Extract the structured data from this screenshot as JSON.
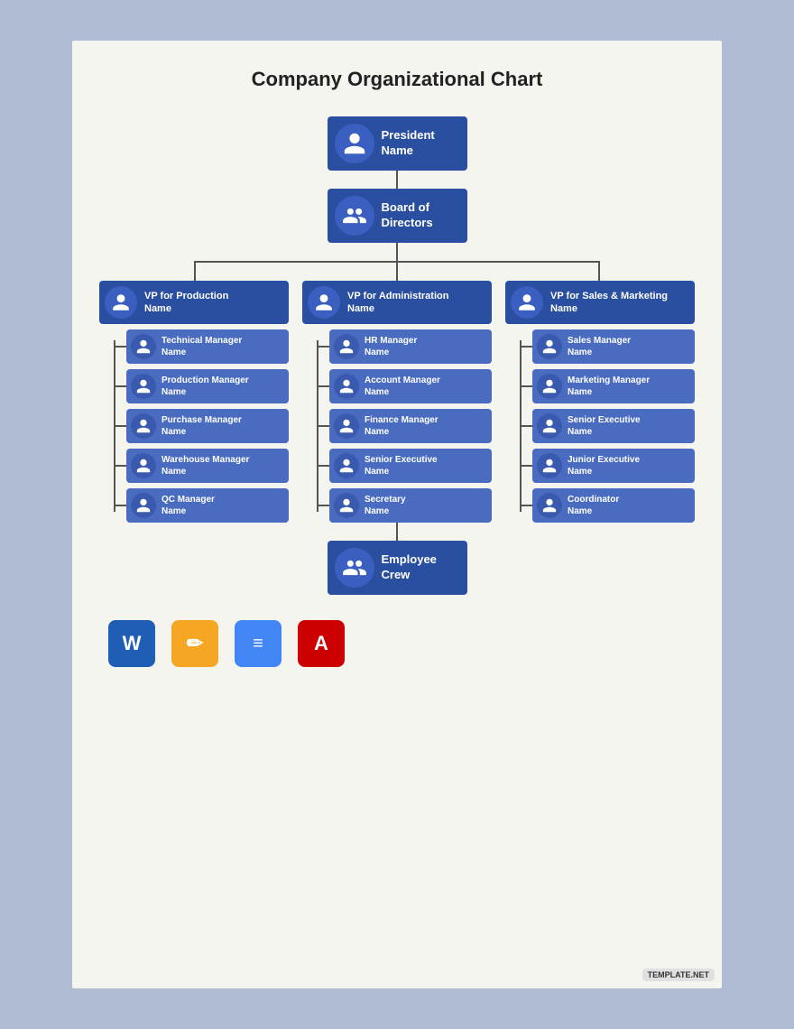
{
  "page": {
    "background": "#b0bcd4",
    "title": "Company Organizational Chart"
  },
  "nodes": {
    "president": {
      "label": "President",
      "sublabel": "Name"
    },
    "board": {
      "label": "Board of",
      "sublabel": "Directors"
    },
    "vp_production": {
      "label": "VP for Production",
      "sublabel": "Name"
    },
    "vp_admin": {
      "label": "VP for Administration",
      "sublabel": "Name"
    },
    "vp_sales": {
      "label": "VP for Sales & Marketing",
      "sublabel": "Name"
    },
    "col1": [
      {
        "label": "Technical Manager",
        "sublabel": "Name"
      },
      {
        "label": "Production Manager",
        "sublabel": "Name"
      },
      {
        "label": "Purchase Manager",
        "sublabel": "Name"
      },
      {
        "label": "Warehouse Manager",
        "sublabel": "Name"
      },
      {
        "label": "QC Manager",
        "sublabel": "Name"
      }
    ],
    "col2": [
      {
        "label": "HR Manager",
        "sublabel": "Name"
      },
      {
        "label": "Account Manager",
        "sublabel": "Name"
      },
      {
        "label": "Finance Manager",
        "sublabel": "Name"
      },
      {
        "label": "Senior Executive",
        "sublabel": "Name"
      },
      {
        "label": "Secretary",
        "sublabel": "Name"
      }
    ],
    "col3": [
      {
        "label": "Sales Manager",
        "sublabel": "Name"
      },
      {
        "label": "Marketing Manager",
        "sublabel": "Name"
      },
      {
        "label": "Senior Executive",
        "sublabel": "Name"
      },
      {
        "label": "Junior Executive",
        "sublabel": "Name"
      },
      {
        "label": "Coordinator",
        "sublabel": "Name"
      }
    ],
    "employee_crew": {
      "label": "Employee",
      "sublabel": "Crew"
    }
  },
  "icons": [
    {
      "name": "word-icon",
      "type": "word",
      "symbol": "W"
    },
    {
      "name": "pages-icon",
      "type": "pages",
      "symbol": "✏"
    },
    {
      "name": "docs-icon",
      "type": "docs",
      "symbol": "≡"
    },
    {
      "name": "pdf-icon",
      "type": "pdf",
      "symbol": "A"
    }
  ],
  "footer": {
    "badge": "TEMPLATE.NET"
  }
}
